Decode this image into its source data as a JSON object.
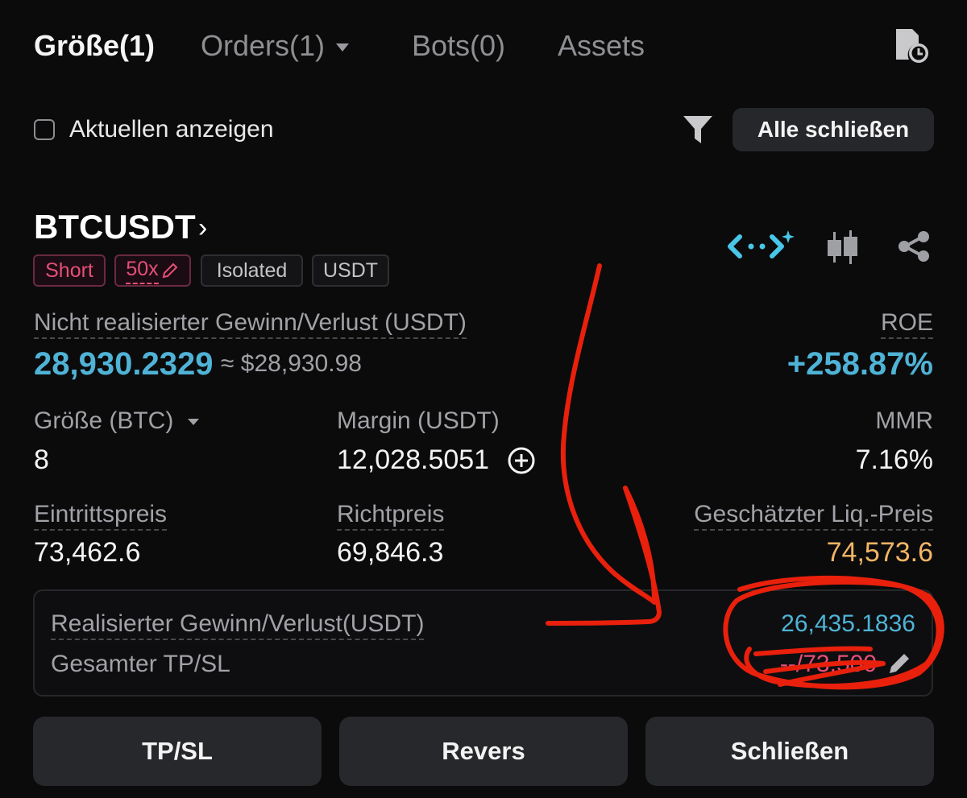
{
  "tabs": [
    {
      "label": "Größe(1)"
    },
    {
      "label": "Orders(1)"
    },
    {
      "label": "Bots(0)"
    },
    {
      "label": "Assets"
    }
  ],
  "filter": {
    "show_current_label": "Aktuellen anzeigen",
    "close_all_label": "Alle schließen"
  },
  "position": {
    "symbol": "BTCUSDT",
    "tags": {
      "side": "Short",
      "leverage": "50x",
      "margin_mode": "Isolated",
      "settle": "USDT"
    },
    "unrealized_pnl_label": "Nicht realisierter Gewinn/Verlust (USDT)",
    "unrealized_pnl_value": "28,930.2329",
    "unrealized_pnl_approx": "≈ $28,930.98",
    "roe_label": "ROE",
    "roe_value": "+258.87%",
    "size_label": "Größe (BTC)",
    "size_value": "8",
    "margin_label": "Margin (USDT)",
    "margin_value": "12,028.5051",
    "mmr_label": "MMR",
    "mmr_value": "7.16%",
    "entry_label": "Eintrittspreis",
    "entry_value": "73,462.6",
    "mark_label": "Richtpreis",
    "mark_value": "69,846.3",
    "liq_label": "Geschätzter Liq.-Preis",
    "liq_value": "74,573.6",
    "realized_label": "Realisierter Gewinn/Verlust(USDT)",
    "realized_value": "26,435.1836",
    "tpsl_label": "Gesamter TP/SL",
    "tpsl_value": "--/73,500"
  },
  "actions": {
    "tpsl": "TP/SL",
    "reverse": "Revers",
    "close": "Schließen"
  },
  "colors": {
    "accent_blue": "#4fb3d6",
    "short_pink": "#e64f78",
    "liq_orange": "#f3b565",
    "annotation_red": "#e8200c",
    "background": "#0b0b0c"
  },
  "icons": [
    "position-history-icon",
    "filter-icon",
    "chevron-right-icon",
    "ai-sparkle-icon",
    "candlestick-chart-icon",
    "share-icon",
    "add-margin-icon",
    "edit-pencil-icon"
  ]
}
